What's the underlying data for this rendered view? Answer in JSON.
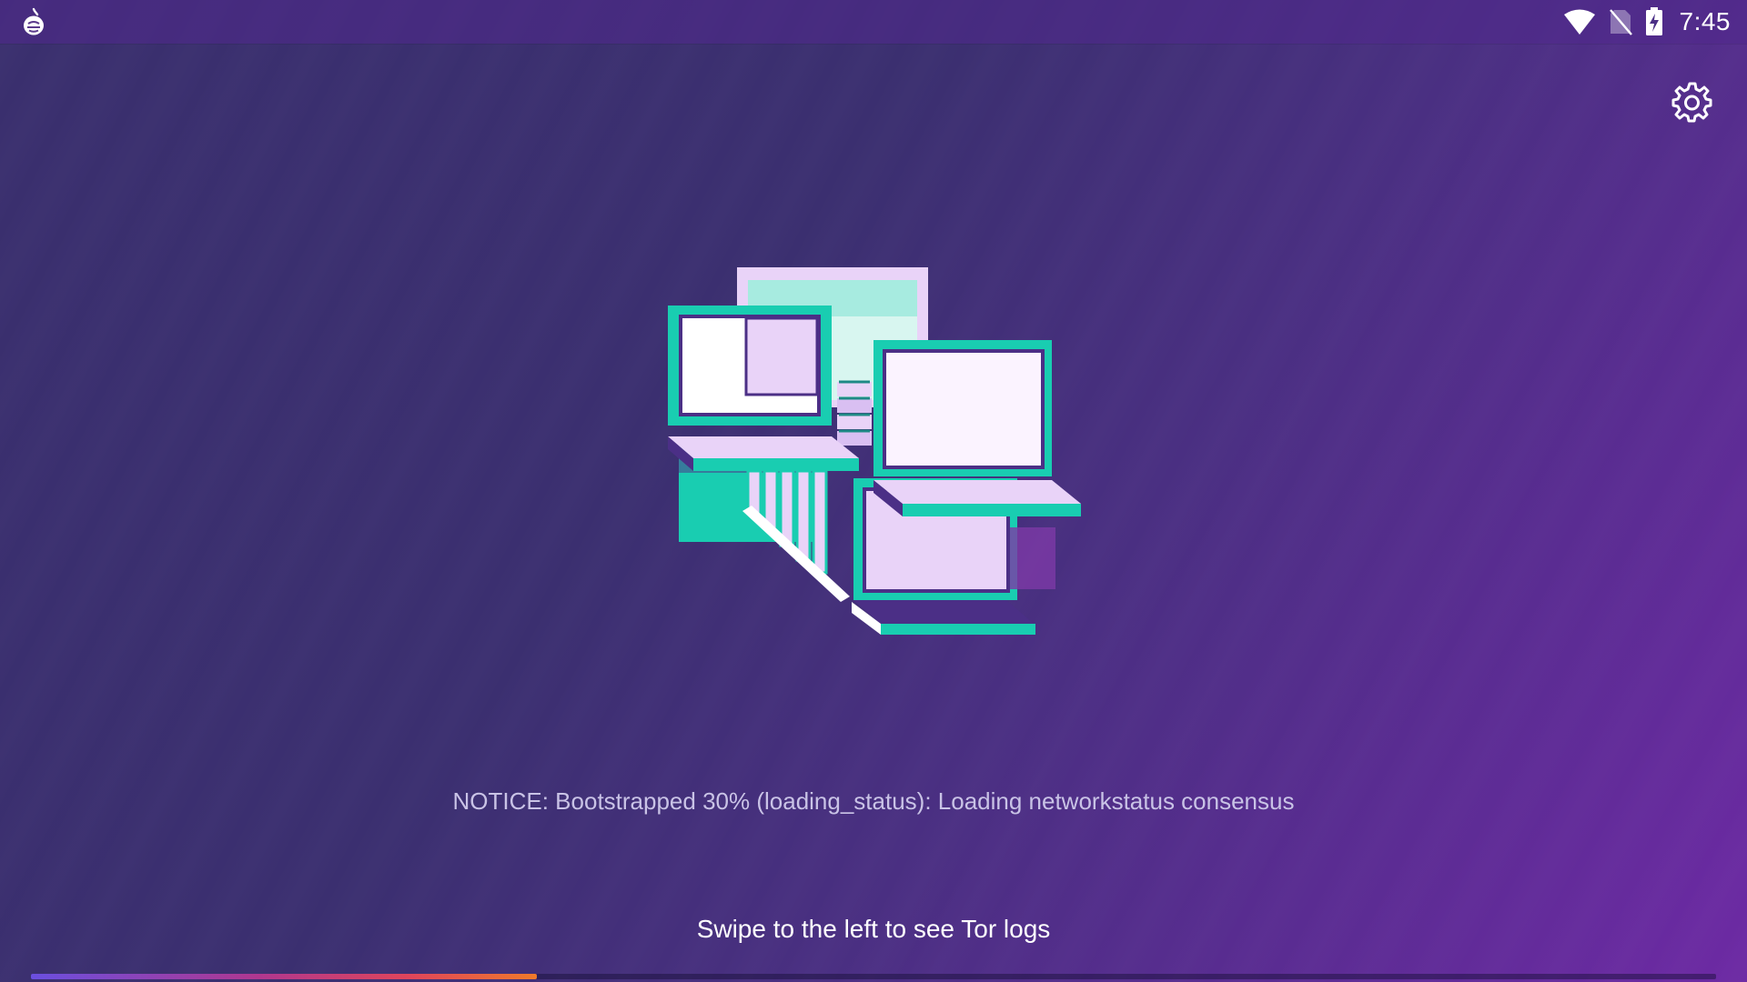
{
  "status_bar": {
    "app_icon": "tor-onion-icon",
    "icons": [
      "wifi-icon",
      "no-sim-icon",
      "battery-charging-icon"
    ],
    "time": "7:45"
  },
  "toolbar": {
    "settings_icon": "gear-icon"
  },
  "main": {
    "illustration": "connected-laptops-illustration",
    "notice": "NOTICE: Bootstrapped 30% (loading_status): Loading networkstatus consensus",
    "swipe_hint": "Swipe to the left to see Tor logs"
  },
  "progress": {
    "value_percent": 30
  },
  "colors": {
    "background_start": "#3a2f6e",
    "background_end": "#6d2aa4",
    "accent_teal": "#19cdb1",
    "lilac": "#e9d3f8",
    "progress_start": "#6a4fe0",
    "progress_end": "#f07a2a"
  }
}
